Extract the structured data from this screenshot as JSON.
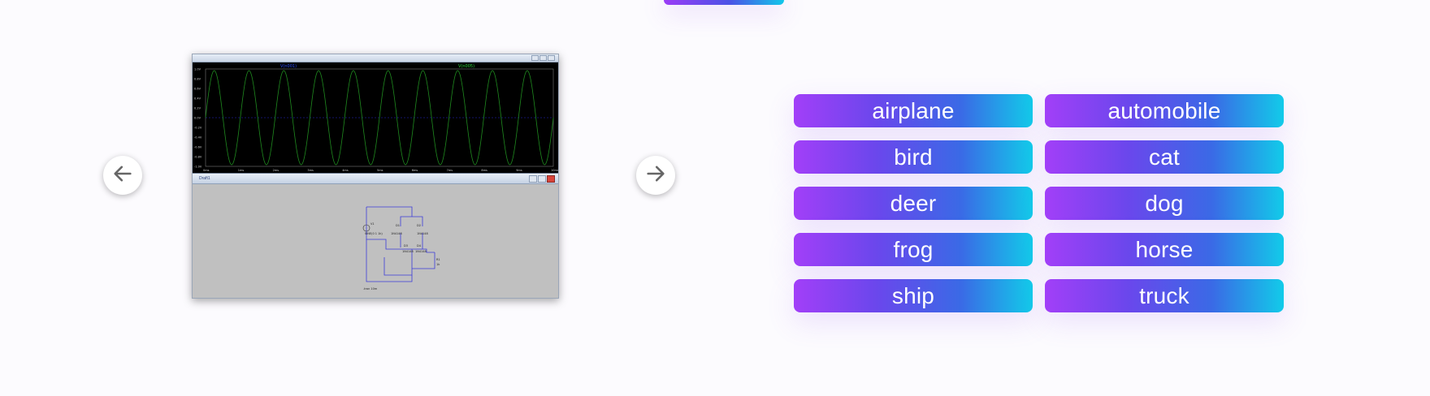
{
  "carousel": {
    "prev_icon": "arrow-left-icon",
    "next_icon": "arrow-right-icon",
    "screenshot": {
      "plot": {
        "trace_label_left": "V(n001)",
        "trace_label_right": "V(n005)",
        "y_ticks": [
          "1.0V",
          "0.8V",
          "0.6V",
          "0.4V",
          "0.2V",
          "0.0V",
          "-0.2V",
          "-0.4V",
          "-0.6V",
          "-0.8V",
          "-1.0V"
        ],
        "x_ticks": [
          "0ms",
          "1ms",
          "2ms",
          "3ms",
          "4ms",
          "5ms",
          "6ms",
          "7ms",
          "8ms",
          "9ms",
          "10ms"
        ],
        "trace_color": "#1f8a1f",
        "background": "#000000"
      },
      "schematic_title": "Draft1",
      "schematic_labels": [
        "V1",
        "SINE(0 1 1k)",
        "D1",
        "D2",
        "D3",
        "D4",
        "1N4148",
        "1N4148",
        "1N4148",
        "1N4148",
        "R1",
        "1k",
        ".tran 10m"
      ]
    }
  },
  "labels": [
    {
      "text": "airplane"
    },
    {
      "text": "automobile"
    },
    {
      "text": "bird"
    },
    {
      "text": "cat"
    },
    {
      "text": "deer"
    },
    {
      "text": "dog"
    },
    {
      "text": "frog"
    },
    {
      "text": "horse"
    },
    {
      "text": "ship"
    },
    {
      "text": "truck"
    }
  ],
  "colors": {
    "gradient_start": "#a23ff8",
    "gradient_end": "#12cbe9",
    "label_text": "#ffffff"
  }
}
